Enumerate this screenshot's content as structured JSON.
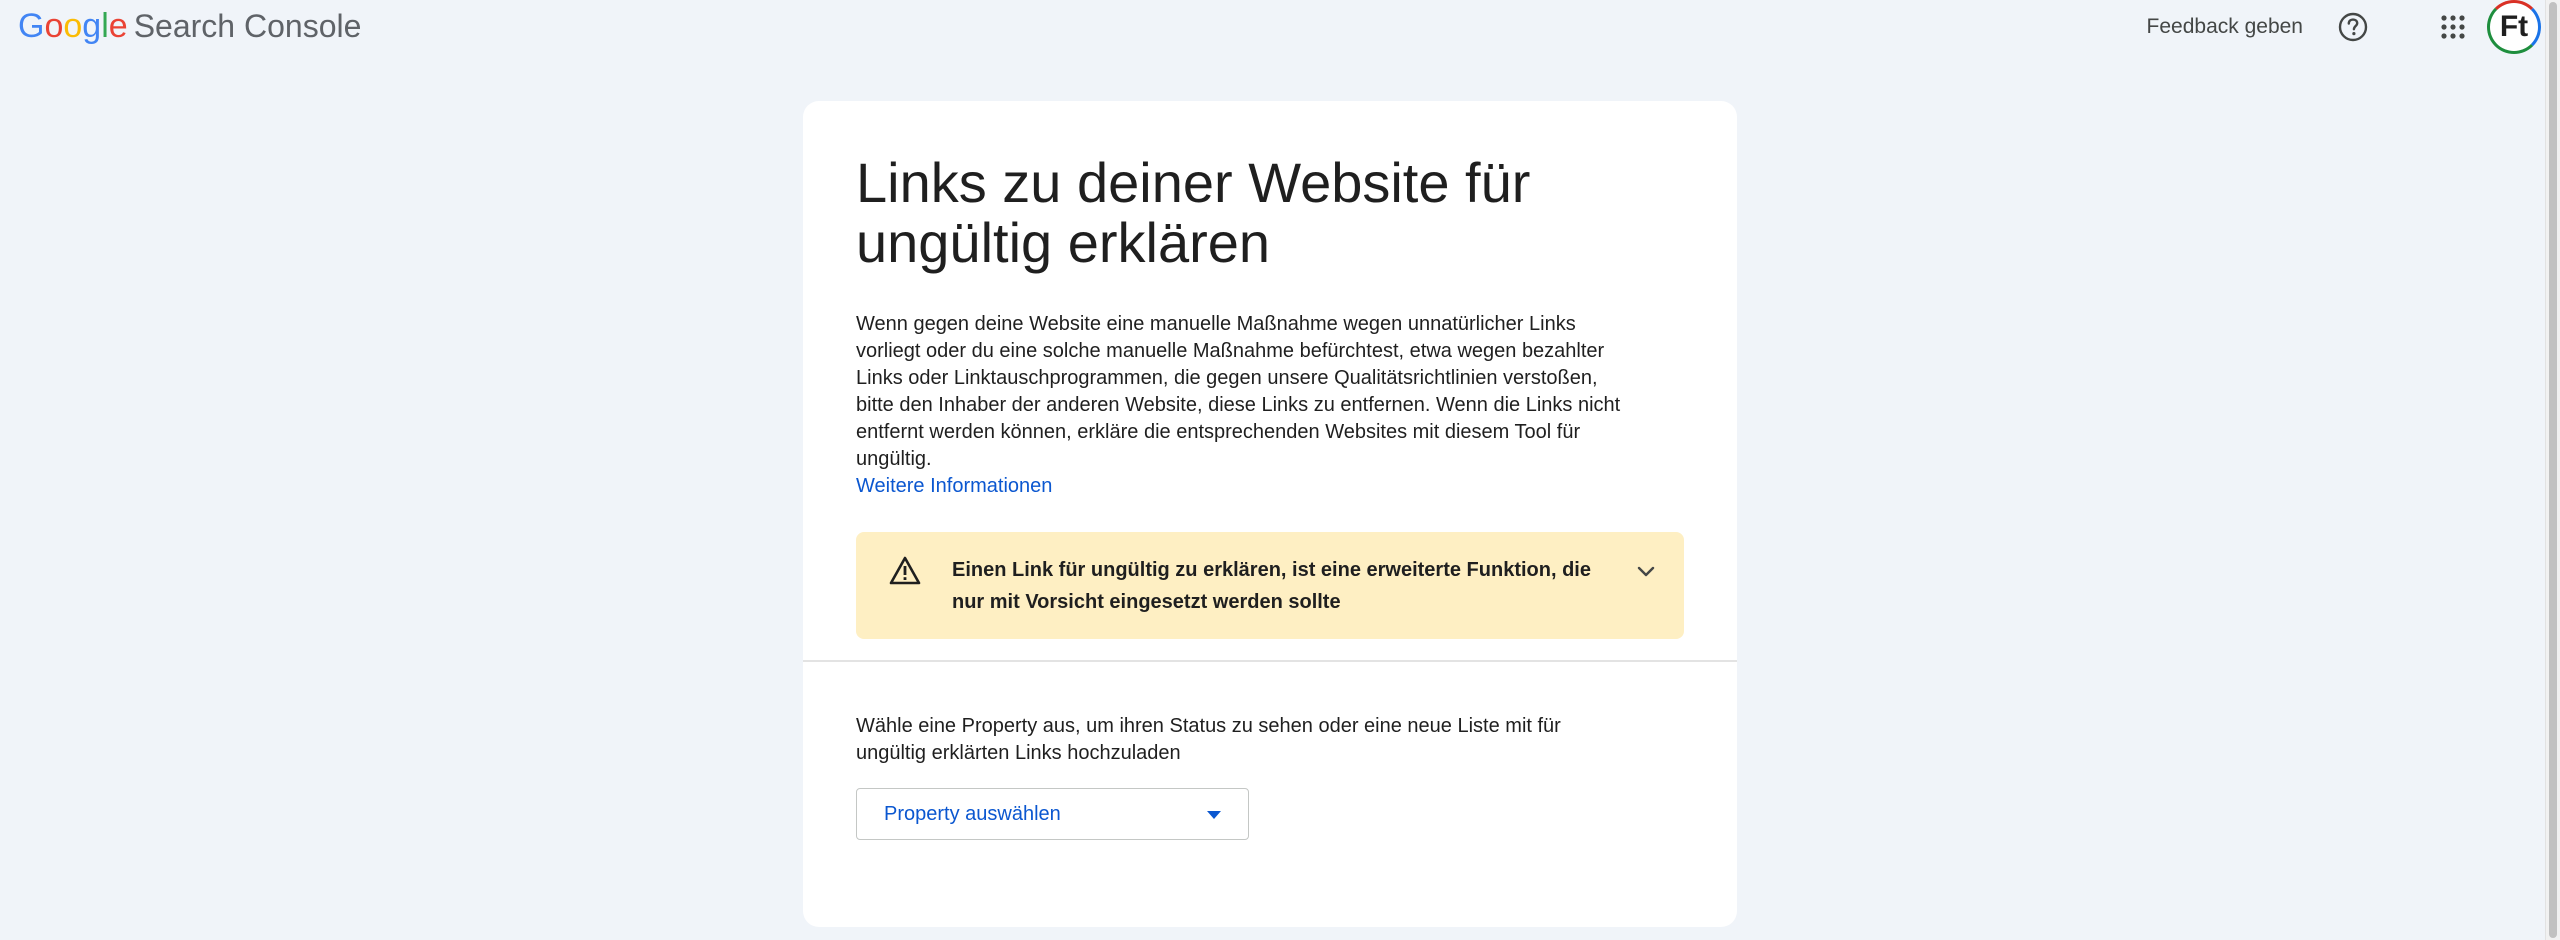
{
  "header": {
    "logo_letters": [
      "G",
      "o",
      "o",
      "g",
      "l",
      "e"
    ],
    "logo_colors": [
      "#4285f4",
      "#ea4335",
      "#fbbc05",
      "#4285f4",
      "#34a853",
      "#ea4335"
    ],
    "product_name": "Search Console",
    "feedback_label": "Feedback geben",
    "help_icon": "help-circle-icon",
    "apps_icon": "apps-grid-icon",
    "avatar_initials": "Ft"
  },
  "card": {
    "title": "Links zu deiner Website für ungültig erklären",
    "description": "Wenn gegen deine Website eine manuelle Maßnahme wegen unnatürlicher Links vorliegt oder du eine solche manuelle Maßnahme befürchtest, etwa wegen bezahlter Links oder Linktauschprogrammen, die gegen unsere Qualitätsrichtlinien verstoßen, bitte den Inhaber der anderen Website, diese Links zu entfernen. Wenn die Links nicht entfernt werden können, erkläre die entsprechenden Websites mit diesem Tool für ungültig.",
    "more_info_link": "Weitere Informationen",
    "warning": {
      "icon": "warning-triangle-icon",
      "text": "Einen Link für ungültig zu erklären, ist eine erweiterte Funktion, die nur mit Vorsicht eingesetzt werden sollte",
      "expand_icon": "chevron-down-icon",
      "background_color": "#feefc3"
    },
    "select_prompt": "Wähle eine Property aus, um ihren Status zu sehen oder eine neue Liste mit für ungültig erklärten Links hochzuladen",
    "property_select": {
      "label": "Property auswählen",
      "arrow_icon": "dropdown-arrow-icon"
    }
  },
  "colors": {
    "page_background": "#f0f4f9",
    "card_background": "#ffffff",
    "link_blue": "#0b57d0"
  }
}
